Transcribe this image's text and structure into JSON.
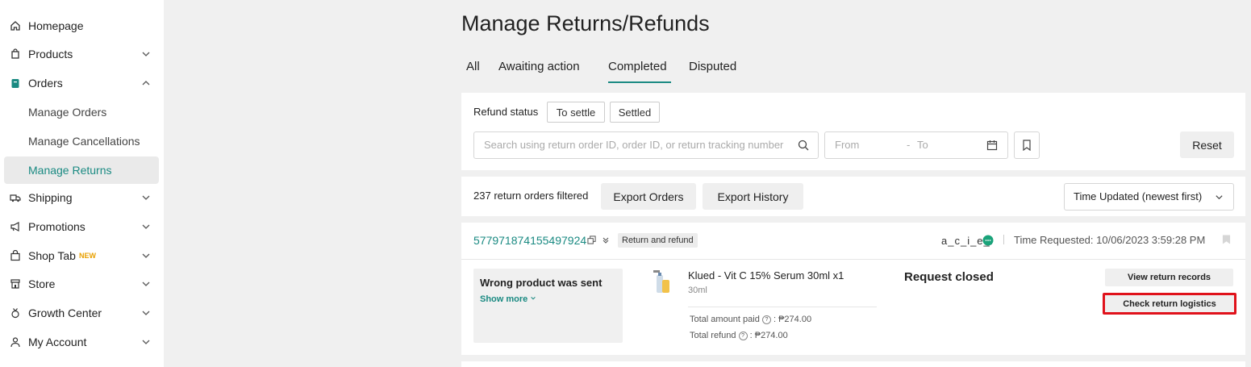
{
  "sidebar": {
    "items": [
      {
        "label": "Homepage",
        "icon": "home-icon"
      },
      {
        "label": "Products",
        "icon": "bag-icon"
      },
      {
        "label": "Orders",
        "icon": "clipboard-icon"
      },
      {
        "label": "Shipping",
        "icon": "truck-icon"
      },
      {
        "label": "Promotions",
        "icon": "megaphone-icon"
      },
      {
        "label": "Shop Tab",
        "icon": "shopping-bag-icon",
        "badge": "NEW"
      },
      {
        "label": "Store",
        "icon": "storefront-icon"
      },
      {
        "label": "Growth Center",
        "icon": "medal-icon"
      },
      {
        "label": "My Account",
        "icon": "user-icon"
      }
    ],
    "orders_sub": [
      {
        "label": "Manage Orders"
      },
      {
        "label": "Manage Cancellations"
      },
      {
        "label": "Manage Returns",
        "active": true
      }
    ],
    "accent": "#1a8a82"
  },
  "page": {
    "title": "Manage Returns/Refunds",
    "tabs": [
      "All",
      "Awaiting action",
      "Completed",
      "Disputed"
    ],
    "active_tab": "Completed"
  },
  "filters": {
    "refund_status_label": "Refund status",
    "chips": [
      "To settle",
      "Settled"
    ],
    "search_placeholder": "Search using return order ID, order ID, or return tracking number",
    "date_from": "From",
    "date_sep": "-",
    "date_to": "To",
    "reset_label": "Reset"
  },
  "results": {
    "count": "237",
    "count_suffix": "return orders filtered",
    "export_orders": "Export Orders",
    "export_history": "Export History",
    "sort_value": "Time Updated (newest first)"
  },
  "order": {
    "id": "577971874155497924",
    "type_badge": "Return and refund",
    "buyer": "a_c_i_e_l",
    "time_requested": "Time Requested: 10/06/2023 3:59:28 PM",
    "reason": "Wrong product was sent",
    "show_more": "Show more",
    "product_name": "Klued - Vit C 15% Serum 30ml x1",
    "variant": "30ml",
    "total_paid_label": "Total amount paid",
    "total_paid": "₱274.00",
    "total_refund_label": "Total refund",
    "total_refund": "₱274.00",
    "status": "Request closed",
    "view_records": "View return records",
    "check_logistics": "Check return logistics",
    "highlight_color": "#e0121b"
  }
}
